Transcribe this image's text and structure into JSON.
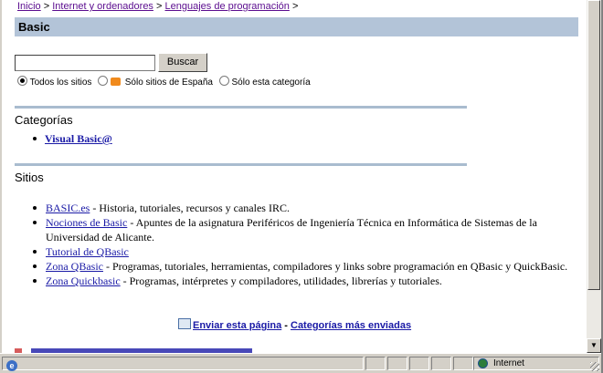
{
  "breadcrumb": {
    "items": [
      "Inicio",
      "Internet y ordenadores",
      "Lenguajes de programación"
    ],
    "separator": ">"
  },
  "page": {
    "title": "Basic"
  },
  "search": {
    "value": "",
    "button_label": "Buscar",
    "options": [
      {
        "label": "Todos los sitios",
        "selected": true
      },
      {
        "label": "Sólo sitios de España",
        "selected": false
      },
      {
        "label": "Sólo esta categoría",
        "selected": false
      }
    ]
  },
  "categories": {
    "heading": "Categorías",
    "items": [
      "Visual Basic@"
    ]
  },
  "sites": {
    "heading": "Sitios",
    "items": [
      {
        "link": "BASIC.es",
        "desc": " - Historia, tutoriales, recursos y canales IRC."
      },
      {
        "link": "Nociones de Basic",
        "desc": " - Apuntes de la asignatura Periféricos de Ingeniería Técnica en Informática de Sistemas de la Universidad de Alicante."
      },
      {
        "link": "Tutorial de QBasic",
        "desc": ""
      },
      {
        "link": "Zona QBasic",
        "desc": " - Programas, tutoriales, herramientas, compiladores y links sobre programación en QBasic y QuickBasic."
      },
      {
        "link": "Zona Quickbasic",
        "desc": " - Programas, intérpretes y compiladores, utilidades, librerías y tutoriales."
      }
    ]
  },
  "footer": {
    "send_page": "Enviar esta página",
    "separator": " - ",
    "most_sent": "Categorías más enviadas"
  },
  "statusbar": {
    "zone": "Internet"
  },
  "colors": {
    "title_bar": "#b3c4d8",
    "rule": "#a9bccf",
    "link": "#1a1aa6",
    "visited": "#5b0d8f"
  }
}
